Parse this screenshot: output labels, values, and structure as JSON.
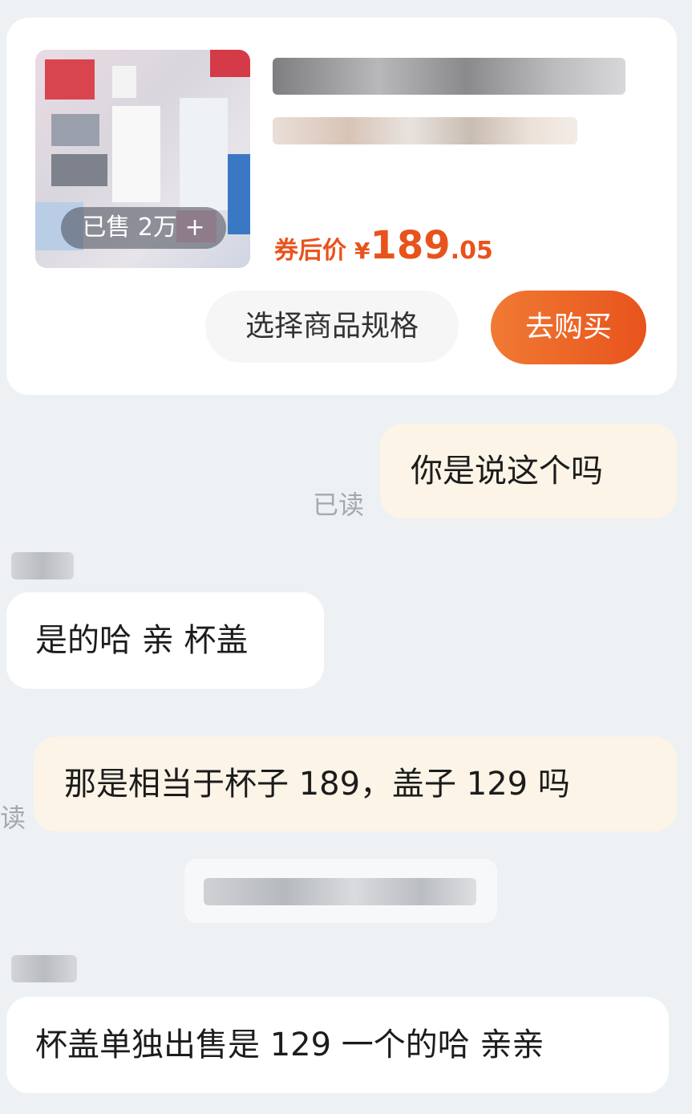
{
  "product_card": {
    "sold_badge": "已售 2万 +",
    "price_label": "券后价",
    "price_currency": "¥",
    "price_integer": "189",
    "price_decimal": ".05",
    "select_spec_label": "选择商品规格",
    "buy_label": "去购买",
    "accent_color": "#e8531c"
  },
  "messages": [
    {
      "sender": "me",
      "text": "你是说这个吗",
      "status": "已读"
    },
    {
      "sender": "them",
      "text": "是的哈 亲 杯盖"
    },
    {
      "sender": "me",
      "text": "那是相当于杯子 189，盖子 129 吗",
      "status": "读"
    },
    {
      "sender": "them",
      "text": "杯盖单独出售是 129 一个的哈 亲亲"
    }
  ]
}
